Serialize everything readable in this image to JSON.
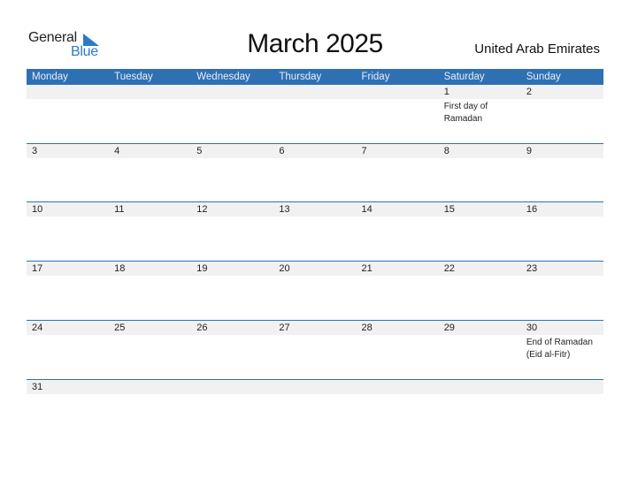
{
  "logo": {
    "part1": "General",
    "part2": "Blue",
    "icon": "triangle-flag-icon"
  },
  "title": "March 2025",
  "country": "United Arab Emirates",
  "colors": {
    "accent": "#2f70b3",
    "logo_blue": "#2b7bc9",
    "strip": "#f1f1f1"
  },
  "weekdays": [
    "Monday",
    "Tuesday",
    "Wednesday",
    "Thursday",
    "Friday",
    "Saturday",
    "Sunday"
  ],
  "weeks": [
    [
      {
        "day": "",
        "event": ""
      },
      {
        "day": "",
        "event": ""
      },
      {
        "day": "",
        "event": ""
      },
      {
        "day": "",
        "event": ""
      },
      {
        "day": "",
        "event": ""
      },
      {
        "day": "1",
        "event": "First day of Ramadan"
      },
      {
        "day": "2",
        "event": ""
      }
    ],
    [
      {
        "day": "3",
        "event": ""
      },
      {
        "day": "4",
        "event": ""
      },
      {
        "day": "5",
        "event": ""
      },
      {
        "day": "6",
        "event": ""
      },
      {
        "day": "7",
        "event": ""
      },
      {
        "day": "8",
        "event": ""
      },
      {
        "day": "9",
        "event": ""
      }
    ],
    [
      {
        "day": "10",
        "event": ""
      },
      {
        "day": "11",
        "event": ""
      },
      {
        "day": "12",
        "event": ""
      },
      {
        "day": "13",
        "event": ""
      },
      {
        "day": "14",
        "event": ""
      },
      {
        "day": "15",
        "event": ""
      },
      {
        "day": "16",
        "event": ""
      }
    ],
    [
      {
        "day": "17",
        "event": ""
      },
      {
        "day": "18",
        "event": ""
      },
      {
        "day": "19",
        "event": ""
      },
      {
        "day": "20",
        "event": ""
      },
      {
        "day": "21",
        "event": ""
      },
      {
        "day": "22",
        "event": ""
      },
      {
        "day": "23",
        "event": ""
      }
    ],
    [
      {
        "day": "24",
        "event": ""
      },
      {
        "day": "25",
        "event": ""
      },
      {
        "day": "26",
        "event": ""
      },
      {
        "day": "27",
        "event": ""
      },
      {
        "day": "28",
        "event": ""
      },
      {
        "day": "29",
        "event": ""
      },
      {
        "day": "30",
        "event": "End of Ramadan (Eid al-Fitr)"
      }
    ],
    [
      {
        "day": "31",
        "event": ""
      },
      {
        "day": "",
        "event": ""
      },
      {
        "day": "",
        "event": ""
      },
      {
        "day": "",
        "event": ""
      },
      {
        "day": "",
        "event": ""
      },
      {
        "day": "",
        "event": ""
      },
      {
        "day": "",
        "event": ""
      }
    ]
  ]
}
